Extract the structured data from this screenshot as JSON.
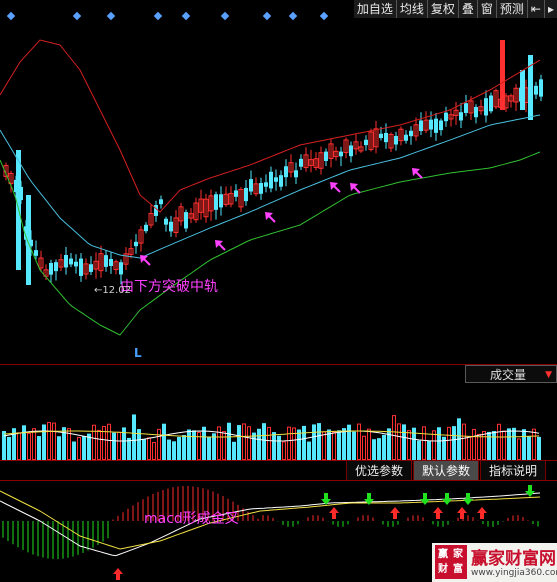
{
  "toolbar": {
    "buttons": [
      "加自选",
      "均线",
      "复权",
      "叠",
      "窗",
      "预测",
      "⇤",
      "▸"
    ]
  },
  "annotations": {
    "breakout": "由下方突破中轨",
    "price_marker": "←12.02",
    "low_marker": "L",
    "macd_cross": "macd形成金叉"
  },
  "volume_panel": {
    "selector_label": "成交量",
    "selector_arrow": "▼"
  },
  "indicator_tabs": [
    "优选参数",
    "默认参数",
    "指标说明"
  ],
  "active_tab_index": 1,
  "watermark": {
    "name": "赢家财富网",
    "url": "www.yingjia360.com",
    "seal_chars": [
      "赢",
      "家",
      "财",
      "富"
    ]
  },
  "colors": {
    "up": "#ff3030",
    "down": "#55e8ff",
    "upper_band": "#d42020",
    "middle_band": "#4ac0e0",
    "lower_band": "#30c030",
    "annotation": "#ff40ff",
    "macd_dif": "#ffffff",
    "macd_dea": "#f0e040",
    "gold_cross": "#ff2a2a",
    "dead_cross": "#20e020"
  },
  "icons": {
    "diamond": "blue-diamond-marker",
    "arrow": "magenta-arrow",
    "cross_up": "red-up-arrow",
    "cross_down": "green-down-arrow"
  }
}
